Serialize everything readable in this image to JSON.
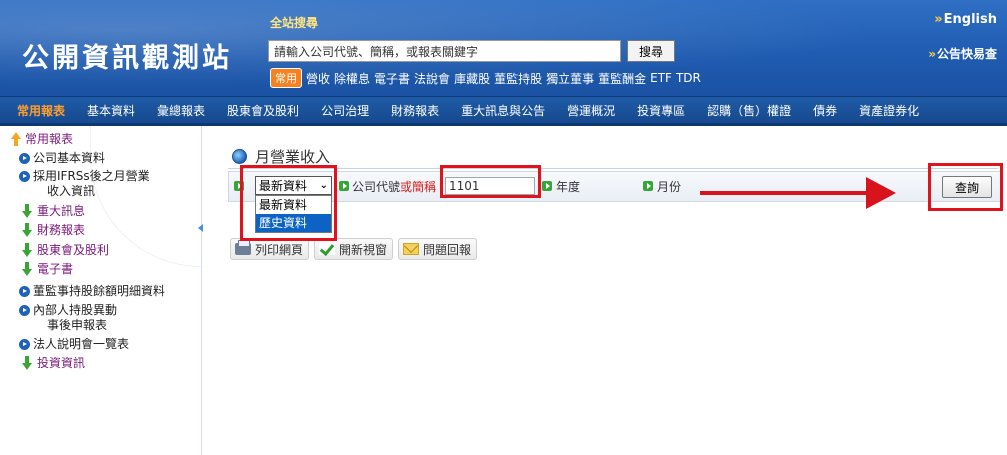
{
  "header": {
    "logo": "公開資訊觀測站",
    "search_label": "全站搜尋",
    "search_placeholder": "請輸入公司代號、簡稱，或報表關鍵字",
    "search_button": "搜尋",
    "quick_badge": "常用",
    "quick_links": [
      "營收",
      "除權息",
      "電子書",
      "法說會",
      "庫藏股",
      "董監持股",
      "獨立董事",
      "董監酬金",
      "ETF",
      "TDR"
    ],
    "english": "English",
    "announcement": "公告快易查"
  },
  "nav": {
    "items": [
      "常用報表",
      "基本資料",
      "彙總報表",
      "股東會及股利",
      "公司治理",
      "財務報表",
      "重大訊息與公告",
      "營運概況",
      "投資專區",
      "認購（售）權證",
      "債券",
      "資產證券化"
    ],
    "active_index": 0
  },
  "sidebar": {
    "title": "常用報表",
    "items": [
      {
        "label": "公司基本資料",
        "icon": "blue-play-icon"
      },
      {
        "label": "採用IFRSs後之月營業",
        "label2": "收入資訊",
        "icon": "blue-play-icon"
      },
      {
        "label": "重大訊息",
        "icon": "green-down-arrow-icon"
      },
      {
        "label": "財務報表",
        "icon": "green-down-arrow-icon"
      },
      {
        "label": "股東會及股利",
        "icon": "green-down-arrow-icon"
      },
      {
        "label": "電子書",
        "icon": "green-down-arrow-icon"
      },
      {
        "label": "董監事持股餘額明細資料",
        "icon": "blue-play-icon"
      },
      {
        "label": "內部人持股異動",
        "label2": "事後申報表",
        "icon": "blue-play-icon"
      },
      {
        "label": "法人說明會一覽表",
        "icon": "blue-play-icon"
      },
      {
        "label": "投資資訊",
        "icon": "green-down-arrow-icon"
      }
    ]
  },
  "main": {
    "title": "月營業收入",
    "query": {
      "mode_selected": "最新資料",
      "mode_options": [
        "最新資料",
        "歷史資料"
      ],
      "mode_highlighted": "歷史資料",
      "company_label": "公司代號",
      "company_or": "或簡稱",
      "company_value": "1101",
      "year_label": "年度",
      "month_label": "月份",
      "submit": "查詢"
    },
    "tools": {
      "print": "列印網頁",
      "new_window": "開新視窗",
      "feedback": "問題回報"
    }
  },
  "colors": {
    "header_blue": "#1f5bb0",
    "nav_active": "#ff9d2e",
    "annotation_red": "#e0121c",
    "dropdown_highlight": "#0d63c5"
  }
}
